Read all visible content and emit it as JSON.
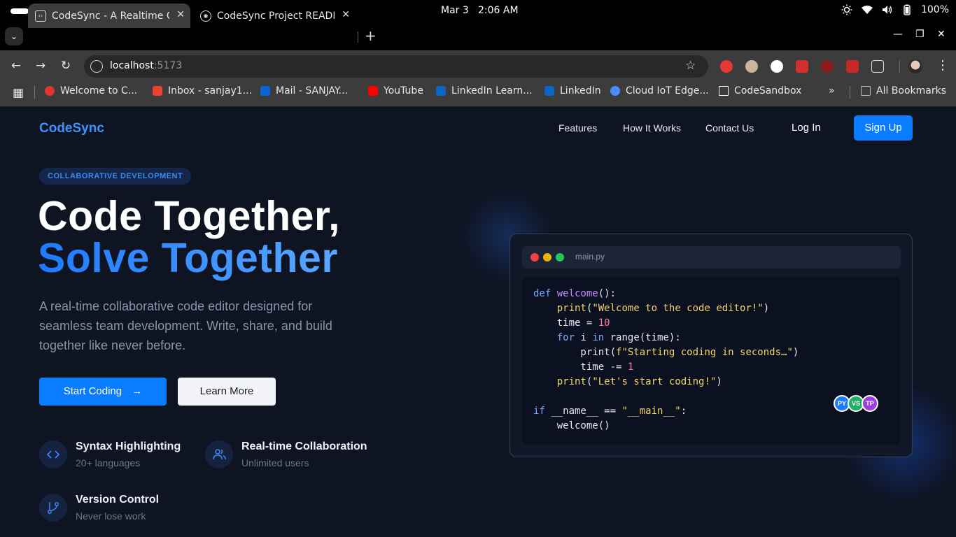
{
  "os": {
    "date": "Mar 3",
    "time": "2:06 AM",
    "battery": "100%"
  },
  "tabs": [
    {
      "title": "CodeSync - A Realtime Co",
      "active": true,
      "close": "✕"
    },
    {
      "title": "CodeSync Project README",
      "active": false,
      "close": "✕"
    }
  ],
  "browser": {
    "new_tab": "+",
    "url_host": "localhost",
    "url_port": ":5173"
  },
  "bookmarks": [
    {
      "label": "Welcome to C...",
      "color": "#e3342f"
    },
    {
      "label": "Inbox - sanjay1...",
      "color": "#ea4335"
    },
    {
      "label": "Mail - SANJAY...",
      "color": "#0a64d8"
    },
    {
      "label": "YouTube",
      "color": "#ff0000"
    },
    {
      "label": "LinkedIn Learn...",
      "color": "#0a66c2"
    },
    {
      "label": "LinkedIn",
      "color": "#0a66c2"
    },
    {
      "label": "Cloud IoT Edge...",
      "color": "#4a8cff"
    },
    {
      "label": "CodeSandbox",
      "color": "#ffffff"
    },
    {
      "label": "All Bookmarks",
      "color": "#bbbbbb"
    }
  ],
  "site": {
    "brand": "CodeSync",
    "nav": [
      "Features",
      "How It Works",
      "Contact Us"
    ],
    "login": "Log In",
    "signup": "Sign Up",
    "badge": "COLLABORATIVE DEVELOPMENT",
    "headline_1": "Code Together,",
    "headline_2": "Solve Together",
    "lead": "A real-time collaborative code editor designed for seamless team development. Write, share, and build together like never before.",
    "cta_primary": "Start Coding",
    "cta_secondary": "Learn More",
    "features": [
      {
        "title": "Syntax Highlighting",
        "sub": "20+ languages",
        "icon": "code-icon"
      },
      {
        "title": "Real-time Collaboration",
        "sub": "Unlimited users",
        "icon": "users-icon"
      },
      {
        "title": "Version Control",
        "sub": "Never lose work",
        "icon": "git-branch-icon"
      }
    ]
  },
  "editor": {
    "filename": "main.py",
    "code": [
      {
        "tokens": [
          {
            "t": "def ",
            "c": "kw"
          },
          {
            "t": "welcome",
            "c": "fn"
          },
          {
            "t": "():",
            "c": ""
          }
        ]
      },
      {
        "tokens": [
          {
            "t": "    ",
            "c": ""
          },
          {
            "t": "print",
            "c": "str"
          },
          {
            "t": "(",
            "c": ""
          },
          {
            "t": "\"Welcome to the code editor!\"",
            "c": "str"
          },
          {
            "t": ")",
            "c": ""
          }
        ]
      },
      {
        "tokens": [
          {
            "t": "    time = ",
            "c": ""
          },
          {
            "t": "10",
            "c": "num"
          }
        ]
      },
      {
        "tokens": [
          {
            "t": "    ",
            "c": ""
          },
          {
            "t": "for",
            "c": "kw"
          },
          {
            "t": " i ",
            "c": ""
          },
          {
            "t": "in",
            "c": "kw"
          },
          {
            "t": " range(time):",
            "c": ""
          }
        ]
      },
      {
        "tokens": [
          {
            "t": "        print(",
            "c": ""
          },
          {
            "t": "f\"Starting coding in seconds…\"",
            "c": "str"
          },
          {
            "t": ")",
            "c": ""
          }
        ]
      },
      {
        "tokens": [
          {
            "t": "        time -= ",
            "c": ""
          },
          {
            "t": "1",
            "c": "num"
          }
        ]
      },
      {
        "tokens": [
          {
            "t": "    ",
            "c": ""
          },
          {
            "t": "print",
            "c": "str"
          },
          {
            "t": "(",
            "c": ""
          },
          {
            "t": "\"Let's start coding!\"",
            "c": "str"
          },
          {
            "t": ")",
            "c": ""
          }
        ]
      },
      {
        "tokens": [
          {
            "t": "",
            "c": ""
          }
        ]
      },
      {
        "tokens": [
          {
            "t": "if",
            "c": "kw"
          },
          {
            "t": " __name__ == ",
            "c": ""
          },
          {
            "t": "\"__main__\"",
            "c": "str"
          },
          {
            "t": ":",
            "c": ""
          }
        ]
      },
      {
        "tokens": [
          {
            "t": "    welcome()",
            "c": ""
          }
        ]
      }
    ],
    "collaborators": [
      {
        "initials": "PY",
        "color": "#1e7bff"
      },
      {
        "initials": "VS",
        "color": "#1fb163"
      },
      {
        "initials": "TP",
        "color": "#9b3fe0"
      }
    ]
  }
}
